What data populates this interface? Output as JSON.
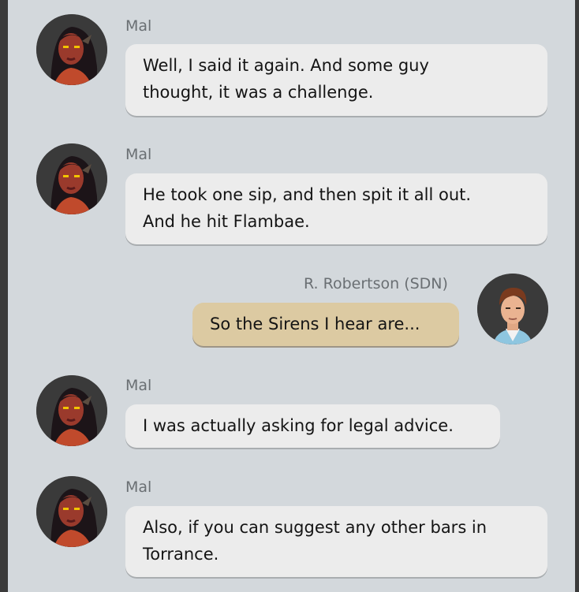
{
  "messages": [
    {
      "sender": "Mal",
      "text": "Well, I said it again. And some guy\nthought, it was a challenge."
    },
    {
      "sender": "Mal",
      "text": "He took one sip, and then spit it all out.\nAnd he hit Flambae."
    },
    {
      "sender": "R. Robertson (SDN)",
      "text": "So the Sirens I hear are..."
    },
    {
      "sender": "Mal",
      "text": "I was actually asking for legal advice."
    },
    {
      "sender": "Mal",
      "text": "Also, if you can suggest any other bars in\nTorrance."
    }
  ],
  "colors": {
    "background": "#d3d8dc",
    "incoming_bubble": "#ececec",
    "outgoing_bubble": "#dccaa2",
    "name_text": "#6a6f73"
  },
  "icons": {
    "mal_avatar": "mal-avatar-icon",
    "robertson_avatar": "robertson-avatar-icon"
  }
}
